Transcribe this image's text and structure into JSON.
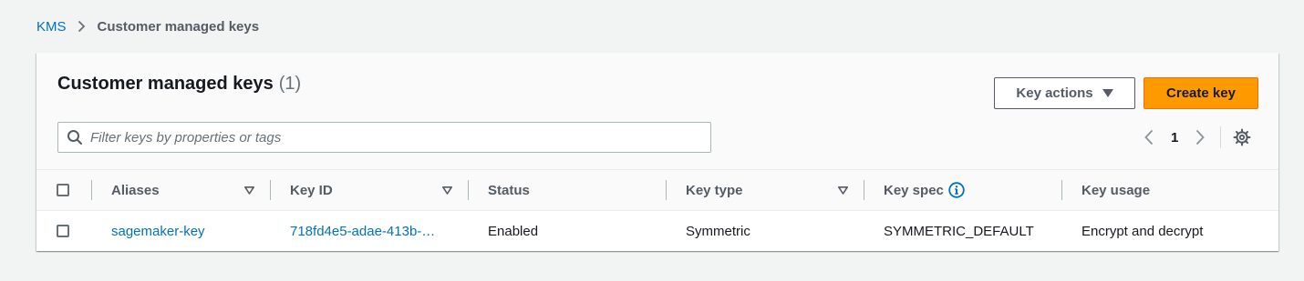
{
  "breadcrumb": {
    "root": "KMS",
    "current": "Customer managed keys"
  },
  "panel": {
    "title": "Customer managed keys",
    "count": "(1)",
    "key_actions_label": "Key actions",
    "create_key_label": "Create key",
    "filter_placeholder": "Filter keys by properties or tags",
    "filter_value": "",
    "page_number": "1"
  },
  "table": {
    "columns": [
      {
        "label": "Aliases",
        "sortable": true
      },
      {
        "label": "Key ID",
        "sortable": true
      },
      {
        "label": "Status",
        "sortable": false
      },
      {
        "label": "Key type",
        "sortable": true
      },
      {
        "label": "Key spec",
        "sortable": false,
        "info": true
      },
      {
        "label": "Key usage",
        "sortable": false
      }
    ],
    "rows": [
      {
        "alias": "sagemaker-key",
        "key_id": "718fd4e5-adae-413b-…",
        "status": "Enabled",
        "key_type": "Symmetric",
        "key_spec": "SYMMETRIC_DEFAULT",
        "key_usage": "Encrypt and decrypt"
      }
    ]
  },
  "colors": {
    "link": "#0073bb",
    "primary_button": "#ff9900",
    "page_background": "#f2f3f3"
  },
  "icons": {
    "breadcrumb_separator": "chevron-right-icon",
    "dropdown": "caret-down-icon",
    "search": "search-icon",
    "prev_page": "chevron-left-icon",
    "next_page": "chevron-right-icon",
    "settings": "gear-icon",
    "sort": "sort-caret-icon",
    "info": "info-icon"
  }
}
